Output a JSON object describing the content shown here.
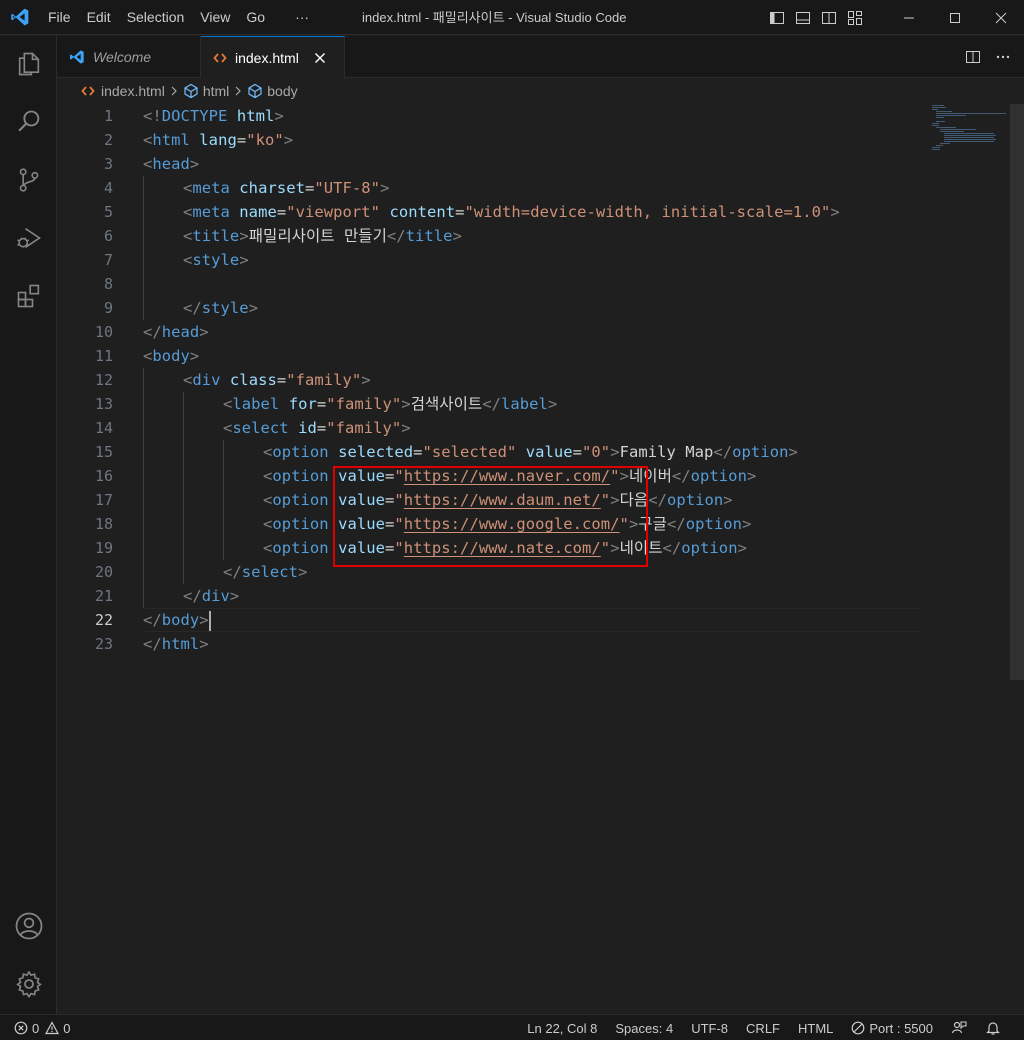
{
  "titlebar": {
    "menu": [
      "File",
      "Edit",
      "Selection",
      "View",
      "Go"
    ],
    "more": "···",
    "window_title": "index.html - 패밀리사이트 - Visual Studio Code"
  },
  "tabs": [
    {
      "label": "Welcome",
      "active": false
    },
    {
      "label": "index.html",
      "active": true
    }
  ],
  "breadcrumb": {
    "file": "index.html",
    "items": [
      "html",
      "body"
    ]
  },
  "editor": {
    "current_line": 22,
    "line_numbers": [
      "1",
      "2",
      "3",
      "4",
      "5",
      "6",
      "7",
      "8",
      "9",
      "10",
      "11",
      "12",
      "13",
      "14",
      "15",
      "16",
      "17",
      "18",
      "19",
      "20",
      "21",
      "22",
      "23"
    ],
    "code": {
      "l1": [
        "<!",
        "DOCTYPE",
        " html",
        ">"
      ],
      "l2": [
        "<",
        "html",
        " lang",
        "=",
        "\"ko\"",
        ">"
      ],
      "l3": [
        "<",
        "head",
        ">"
      ],
      "l4": [
        "<",
        "meta",
        " charset",
        "=",
        "\"UTF-8\"",
        ">"
      ],
      "l5": [
        "<",
        "meta",
        " name",
        "=",
        "\"viewport\"",
        " content",
        "=",
        "\"width=device-width, initial-scale=1.0\"",
        ">"
      ],
      "l6": [
        "<",
        "title",
        ">",
        "패밀리사이트 만들기",
        "</",
        "title",
        ">"
      ],
      "l7": [
        "<",
        "style",
        ">"
      ],
      "l9": [
        "</",
        "style",
        ">"
      ],
      "l10": [
        "</",
        "head",
        ">"
      ],
      "l11": [
        "<",
        "body",
        ">"
      ],
      "l12": [
        "<",
        "div",
        " class",
        "=",
        "\"family\"",
        ">"
      ],
      "l13": [
        "<",
        "label",
        " for",
        "=",
        "\"family\"",
        ">",
        "검색사이트",
        "</",
        "label",
        ">"
      ],
      "l14": [
        "<",
        "select",
        " id",
        "=",
        "\"family\"",
        ">"
      ],
      "l15": [
        "<",
        "option",
        " selected",
        "=",
        "\"selected\"",
        " value",
        "=",
        "\"0\"",
        ">",
        "Family Map",
        "</",
        "option",
        ">"
      ],
      "l16": [
        "<",
        "option",
        " value",
        "=",
        "\"",
        "https://www.naver.com/",
        "\"",
        ">",
        "네이버",
        "</",
        "option",
        ">"
      ],
      "l17": [
        "<",
        "option",
        " value",
        "=",
        "\"",
        "https://www.daum.net/",
        "\"",
        ">",
        "다음",
        "</",
        "option",
        ">"
      ],
      "l18": [
        "<",
        "option",
        " value",
        "=",
        "\"",
        "https://www.google.com/",
        "\"",
        ">",
        "구글",
        "</",
        "option",
        ">"
      ],
      "l19": [
        "<",
        "option",
        " value",
        "=",
        "\"",
        "https://www.nate.com/",
        "\"",
        ">",
        "네이트",
        "</",
        "option",
        ">"
      ],
      "l20": [
        "</",
        "select",
        ">"
      ],
      "l21": [
        "</",
        "div",
        ">"
      ],
      "l22": [
        "</",
        "body",
        ">"
      ],
      "l23": [
        "</",
        "html",
        ">"
      ]
    }
  },
  "statusbar": {
    "errors": "0",
    "warnings": "0",
    "position": "Ln 22, Col 8",
    "spaces": "Spaces: 4",
    "encoding": "UTF-8",
    "eol": "CRLF",
    "language": "HTML",
    "port": "Port : 5500"
  },
  "colors": {
    "tag": "#569cd6",
    "attribute": "#9cdcfe",
    "string": "#ce9178",
    "punctuation": "#808080",
    "highlight_box": "#e00000",
    "accent": "#0078d4"
  }
}
